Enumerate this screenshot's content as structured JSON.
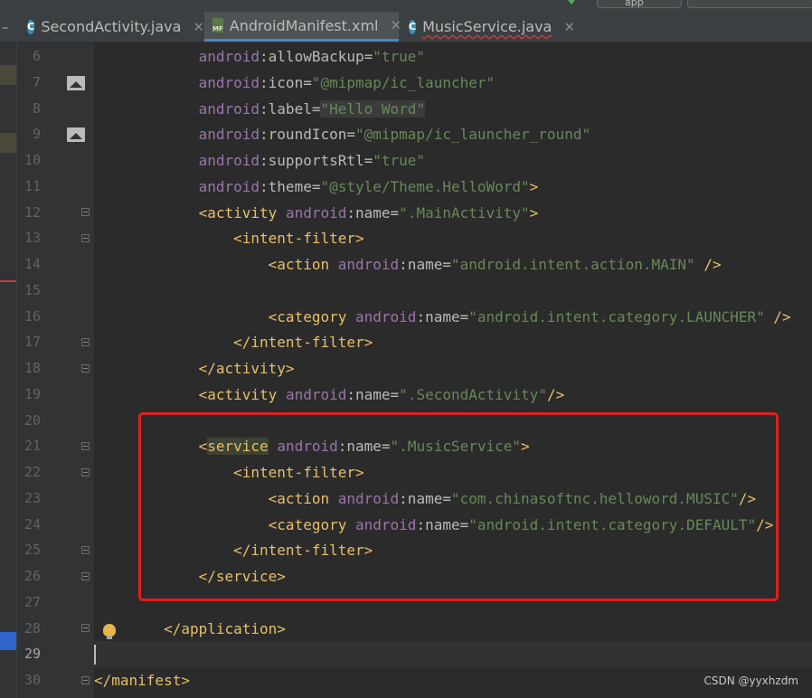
{
  "tabs": [
    {
      "label": "SecondActivity.java",
      "icon": "java-class-icon",
      "active": false
    },
    {
      "label": "AndroidManifest.xml",
      "icon": "manifest-file-icon",
      "active": true
    },
    {
      "label": "MusicService.java",
      "icon": "java-class-icon",
      "active": false
    }
  ],
  "toolbar": {
    "run_config": "app"
  },
  "editor": {
    "current_line": 29,
    "lines": [
      {
        "n": 6,
        "text": "            android:allowBackup=\"true\""
      },
      {
        "n": 7,
        "text": "            android:icon=\"@mipmap/ic_launcher\""
      },
      {
        "n": 8,
        "text": "            android:label=\"Hello Word\""
      },
      {
        "n": 9,
        "text": "            android:roundIcon=\"@mipmap/ic_launcher_round\""
      },
      {
        "n": 10,
        "text": "            android:supportsRtl=\"true\""
      },
      {
        "n": 11,
        "text": "            android:theme=\"@style/Theme.HelloWord\">"
      },
      {
        "n": 12,
        "text": "            <activity android:name=\".MainActivity\">"
      },
      {
        "n": 13,
        "text": "                <intent-filter>"
      },
      {
        "n": 14,
        "text": "                    <action android:name=\"android.intent.action.MAIN\" />"
      },
      {
        "n": 15,
        "text": ""
      },
      {
        "n": 16,
        "text": "                    <category android:name=\"android.intent.category.LAUNCHER\" />"
      },
      {
        "n": 17,
        "text": "                </intent-filter>"
      },
      {
        "n": 18,
        "text": "            </activity>"
      },
      {
        "n": 19,
        "text": "            <activity android:name=\".SecondActivity\"/>"
      },
      {
        "n": 20,
        "text": ""
      },
      {
        "n": 21,
        "text": "            <service android:name=\".MusicService\">"
      },
      {
        "n": 22,
        "text": "                <intent-filter>"
      },
      {
        "n": 23,
        "text": "                    <action android:name=\"com.chinasoftnc.helloword.MUSIC\"/>"
      },
      {
        "n": 24,
        "text": "                    <category android:name=\"android.intent.category.DEFAULT\"/>"
      },
      {
        "n": 25,
        "text": "                </intent-filter>"
      },
      {
        "n": 26,
        "text": "            </service>"
      },
      {
        "n": 27,
        "text": ""
      },
      {
        "n": 28,
        "text": "        </application>"
      },
      {
        "n": 29,
        "text": ""
      },
      {
        "n": 30,
        "text": "</manifest>"
      }
    ]
  },
  "watermark": "CSDN @yyxhzdm",
  "colors": {
    "background": "#2b2b2b",
    "tag": "#e8bf6a",
    "namespace": "#9876aa",
    "attribute": "#bababa",
    "value": "#6a8759",
    "annotation_box": "#e0201e"
  }
}
